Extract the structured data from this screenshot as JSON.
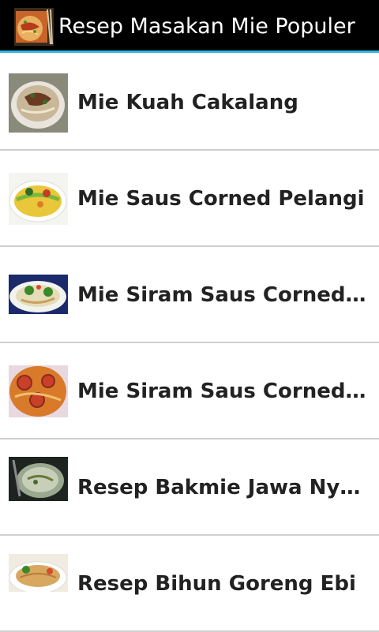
{
  "app": {
    "title": "Resep Masakan Mie Populer",
    "icon": "noodle-dish-icon"
  },
  "colors": {
    "titlebar_bg": "#000000",
    "accent": "#33b5e5",
    "divider": "#cfcfcf",
    "text": "#222222"
  },
  "recipes": [
    {
      "label": "Mie Kuah Cakalang",
      "thumb": "noodle-soup-photo"
    },
    {
      "label": "Mie Saus Corned Pelangi",
      "thumb": "rainbow-noodle-photo"
    },
    {
      "label": "Mie Siram Saus Corned Br...",
      "thumb": "noodle-broccoli-photo"
    },
    {
      "label": "Mie Siram Saus Corned Te...",
      "thumb": "noodle-tomato-photo"
    },
    {
      "label": "Resep Bakmie Jawa Nyemek",
      "thumb": "bakmie-jawa-photo"
    },
    {
      "label": "Resep Bihun Goreng Ebi",
      "thumb": "fried-vermicelli-photo"
    }
  ]
}
